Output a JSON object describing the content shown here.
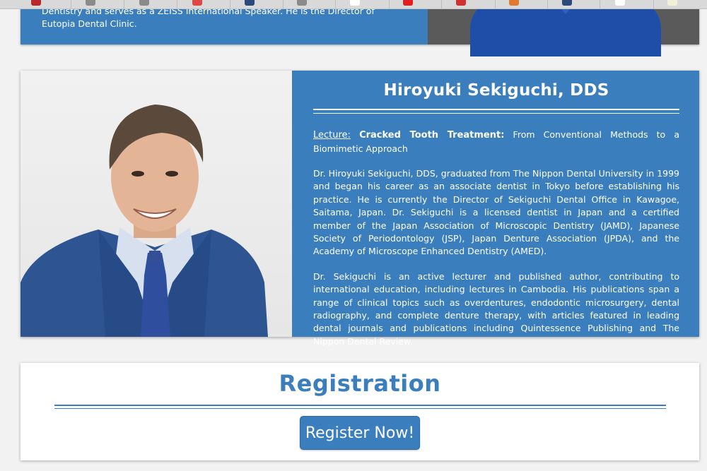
{
  "prev_speaker": {
    "bio_fragment": "Dentistry and serves as a ZEISS International Speaker. He is the Director of Eutopia Dental Clinic."
  },
  "speaker": {
    "name": "Hiroyuki Sekiguchi, DDS",
    "lecture_label": "Lecture:",
    "lecture_title": "Cracked Tooth Treatment:",
    "lecture_subtitle": " From Conventional Methods to a Biomimetic Approach",
    "bio_paragraph_1": "Dr. Hiroyuki Sekiguchi, DDS, graduated from The Nippon Dental University in 1999 and began his career as an associate dentist in Tokyo before establishing his practice. He is currently the Director of Sekiguchi Dental Office in Kawagoe, Saitama, Japan. Dr. Sekiguchi is a licensed dentist in Japan and a certified member of the Japan Association of Microscopic Dentistry (JAMD), Japanese Society of Periodontology (JSP), Japan Denture Association (JPDA), and the Academy of Microscope Enhanced Dentistry (AMED).",
    "bio_paragraph_2": "Dr. Sekiguchi is an active lecturer and published author, contributing to international education, including lectures in Cambodia. His publications span a range of clinical topics such as overdentures, endodontic microsurgery, dental radiography, and complete denture therapy, with articles featured in leading dental journals and publications including Quintessence Publishing and The Nippon Dental Review."
  },
  "registration": {
    "title": "Registration",
    "button_label": "Register Now!"
  },
  "colors": {
    "accent": "#3a7ebd",
    "card_text": "#ffffff",
    "page_background": "#f2f2f2"
  }
}
